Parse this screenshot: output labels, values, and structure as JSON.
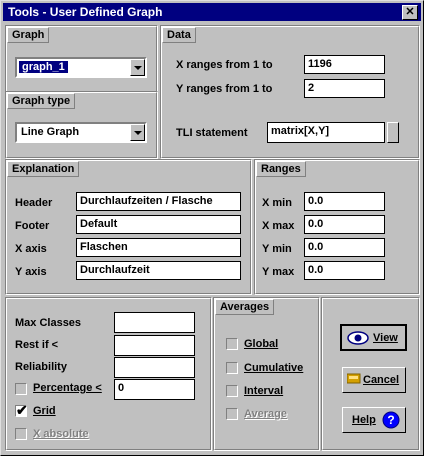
{
  "window": {
    "title": "Tools - User Defined Graph",
    "close": "✕"
  },
  "graph": {
    "legend": "Graph",
    "selected": "graph_1"
  },
  "graph_type": {
    "legend": "Graph type",
    "selected": "Line Graph"
  },
  "data": {
    "legend": "Data",
    "x_label": "X ranges from 1 to",
    "x_value": "1196",
    "y_label": "Y ranges from 1 to",
    "y_value": "2",
    "tli_label": "TLI statement",
    "tli_value": "matrix[X,Y]"
  },
  "explanation": {
    "legend": "Explanation",
    "header_label": "Header",
    "header_value": "Durchlaufzeiten / Flasche",
    "footer_label": "Footer",
    "footer_value": "Default",
    "xaxis_label": "X axis",
    "xaxis_value": "Flaschen",
    "yaxis_label": "Y axis",
    "yaxis_value": "Durchlaufzeit"
  },
  "ranges": {
    "legend": "Ranges",
    "xmin_label": "X min",
    "xmin_value": "0.0",
    "xmax_label": "X max",
    "xmax_value": "0.0",
    "ymin_label": "Y min",
    "ymin_value": "0.0",
    "ymax_label": "Y max",
    "ymax_value": "0.0"
  },
  "classes": {
    "max_classes_label": "Max Classes",
    "max_classes_value": "",
    "rest_label": "Rest if <",
    "rest_value": "",
    "reliability_label": "Reliability",
    "reliability_value": "",
    "percentage_label": "Percentage <",
    "percentage_value": "0",
    "percentage_checked": false,
    "grid_label": "Grid",
    "grid_checked": true,
    "xabsolute_label": "X absolute",
    "xabsolute_checked": false,
    "xabsolute_disabled": true
  },
  "averages": {
    "legend": "Averages",
    "global_label": "Global",
    "cumulative_label": "Cumulative",
    "interval_label": "Interval",
    "average_label": "Average"
  },
  "buttons": {
    "view": "View",
    "cancel": "Cancel",
    "help": "Help"
  }
}
